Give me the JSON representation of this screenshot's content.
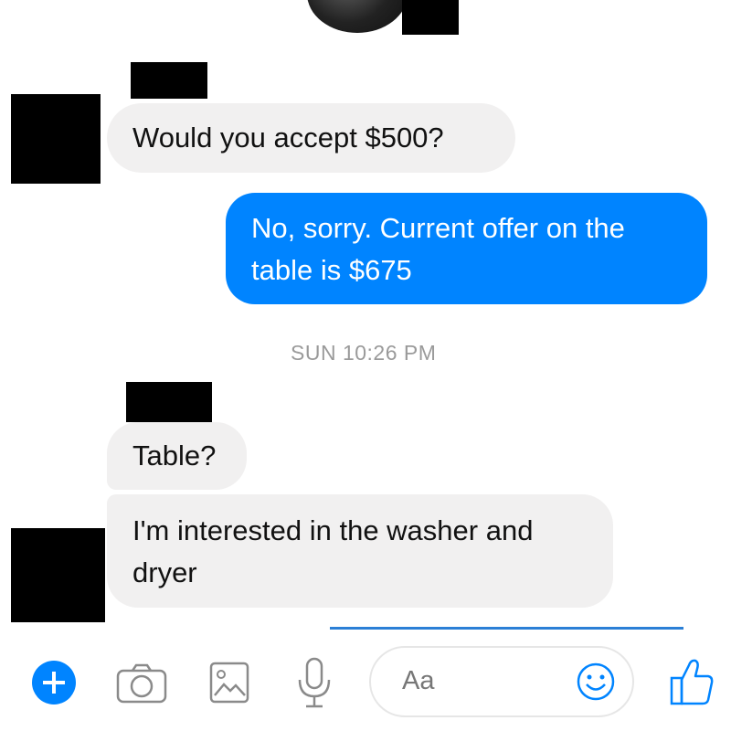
{
  "colors": {
    "accent": "#0084ff",
    "incoming_bubble": "#f1f0f0",
    "timestamp_gray": "#9a9a9a"
  },
  "messages": [
    {
      "direction": "incoming",
      "text": "Would you accept $500?"
    },
    {
      "direction": "outgoing",
      "line1": "No, sorry. Current offer on the",
      "line2": "table is $675"
    },
    {
      "direction": "incoming",
      "text": "Table?"
    },
    {
      "direction": "incoming",
      "line1": "I'm interested in the washer and",
      "line2": "dryer"
    }
  ],
  "timestamp": "SUN 10:26 PM",
  "composer": {
    "placeholder": "Aa",
    "icons": [
      "plus-icon",
      "camera-icon",
      "image-icon",
      "microphone-icon",
      "emoji-icon",
      "thumbs-up-icon"
    ]
  }
}
